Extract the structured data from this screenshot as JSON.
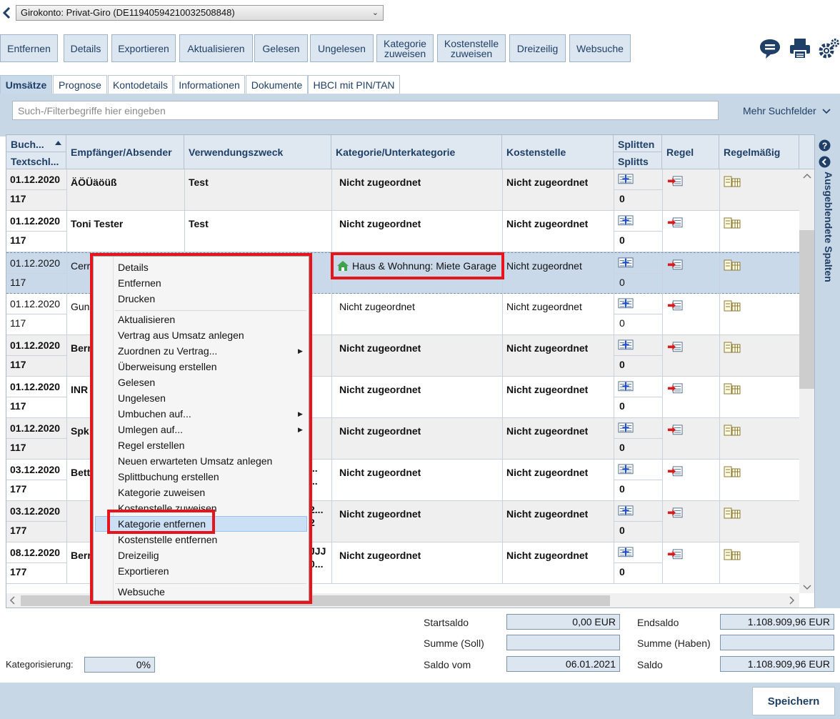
{
  "account": {
    "select_value": "Girokonto: Privat-Giro (DE11940594210032508848)"
  },
  "toolbar": {
    "buttons": [
      {
        "label": "Entfernen"
      },
      {
        "label": "Details"
      },
      {
        "label": "Exportieren"
      },
      {
        "label": "Aktualisieren"
      },
      {
        "label": "Gelesen"
      },
      {
        "label": "Ungelesen"
      },
      {
        "label": "Kategorie\nzuweisen"
      },
      {
        "label": "Kostenstelle\nzuweisen"
      },
      {
        "label": "Dreizeilig"
      },
      {
        "label": "Websuche"
      }
    ],
    "icons": [
      "chat-icon",
      "print-icon",
      "settings-icon"
    ]
  },
  "tabs": [
    {
      "label": "Umsätze",
      "active": true
    },
    {
      "label": "Prognose"
    },
    {
      "label": "Kontodetails"
    },
    {
      "label": "Informationen"
    },
    {
      "label": "Dokumente"
    },
    {
      "label": "HBCI mit PIN/TAN"
    }
  ],
  "search": {
    "placeholder": "Such-/Filterbegriffe hier eingeben",
    "more_label": "Mehr Suchfelder"
  },
  "table": {
    "headers": {
      "buch": "Buch...",
      "textschl": "Textschl...",
      "empfaenger": "Empfänger/Absender",
      "zweck": "Verwendungszweck",
      "kategorie": "Kategorie/Unterkategorie",
      "kostenstelle": "Kostenstelle",
      "splitten": "Splitten",
      "splitts": "Splitts",
      "regel": "Regel",
      "regelmaessig": "Regelmäßig"
    },
    "rows": [
      {
        "date": "01.12.2020",
        "code": "117",
        "empfaenger": "ÄÖÜäöüß",
        "zweck": "Test",
        "kategorie": "Nicht zugeordnet",
        "kostenstelle": "Nicht zugeordnet",
        "splitts": "0",
        "bold": true,
        "alt": true
      },
      {
        "date": "01.12.2020",
        "code": "117",
        "empfaenger": "Toni Tester",
        "zweck": "Test",
        "kategorie": "Nicht zugeordnet",
        "kostenstelle": "Nicht zugeordnet",
        "splitts": "0",
        "bold": true,
        "alt": false
      },
      {
        "date": "01.12.2020",
        "code": "117",
        "empfaenger": "Cerr",
        "zweck": "",
        "kategorie": "Haus & Wohnung: Miete Garage",
        "kostenstelle": "Nicht zugeordnet",
        "splitts": "0",
        "bold": false,
        "selected": true
      },
      {
        "date": "01.12.2020",
        "code": "117",
        "empfaenger": "Gun",
        "zweck": "",
        "kategorie": "Nicht zugeordnet",
        "kostenstelle": "Nicht zugeordnet",
        "splitts": "0",
        "bold": false,
        "alt": false
      },
      {
        "date": "01.12.2020",
        "code": "117",
        "empfaenger": "Berr",
        "zweck": "",
        "kategorie": "Nicht zugeordnet",
        "kostenstelle": "Nicht zugeordnet",
        "splitts": "0",
        "bold": true,
        "alt": true
      },
      {
        "date": "01.12.2020",
        "code": "117",
        "empfaenger": "INR",
        "zweck": "",
        "kategorie": "Nicht zugeordnet",
        "kostenstelle": "Nicht zugeordnet",
        "splitts": "0",
        "bold": true,
        "alt": false
      },
      {
        "date": "01.12.2020",
        "code": "117",
        "empfaenger": "Spk",
        "zweck": "",
        "kategorie": "Nicht zugeordnet",
        "kostenstelle": "Nicht zugeordnet",
        "splitts": "0",
        "bold": true,
        "alt": true
      },
      {
        "date": "03.12.2020",
        "code": "177",
        "empfaenger": "Bett",
        "zweck": "...",
        "zweck2": "...",
        "kategorie": "Nicht zugeordnet",
        "kostenstelle": "Nicht zugeordnet",
        "splitts": "0",
        "bold": true,
        "alt": false
      },
      {
        "date": "03.12.2020",
        "code": "177",
        "empfaenger": "",
        "zweck": "2...",
        "zweck2": "2",
        "kategorie": "Nicht zugeordnet",
        "kostenstelle": "Nicht zugeordnet",
        "splitts": "0",
        "bold": true,
        "alt": true
      },
      {
        "date": "08.12.2020",
        "code": "177",
        "empfaenger": "Berr",
        "zweck": "JJJ",
        "zweck2": "0...",
        "kategorie": "Nicht zugeordnet",
        "kostenstelle": "Nicht zugeordnet",
        "splitts": "0",
        "bold": true,
        "alt": false
      }
    ]
  },
  "side_panel": {
    "label": "Ausgeblendete Spalten"
  },
  "context_menu": {
    "group1": [
      "Details",
      "Entfernen",
      "Drucken"
    ],
    "group2": [
      "Aktualisieren",
      "Vertrag aus Umsatz anlegen",
      "Zuordnen zu Vertrag...",
      "Überweisung erstellen",
      "Gelesen",
      "Ungelesen",
      "Umbuchen auf...",
      "Umlegen auf...",
      "Regel erstellen",
      "Neuen erwarteten Umsatz anlegen",
      "Splittbuchung erstellen",
      "Kategorie zuweisen",
      "Kostenstelle zuweisen",
      "Kategorie entfernen",
      "Kostenstelle entfernen",
      "Dreizeilig",
      "Exportieren"
    ],
    "group3": [
      "Websuche"
    ],
    "highlighted": "Kategorie entfernen"
  },
  "summary": {
    "startsaldo_label": "Startsaldo",
    "startsaldo": "0,00 EUR",
    "endsaldo_label": "Endsaldo",
    "endsaldo": "1.108.909,96 EUR",
    "soll_label": "Summe (Soll)",
    "soll": "",
    "haben_label": "Summe (Haben)",
    "haben": "",
    "saldo_vom_label": "Saldo vom",
    "saldo_vom": "06.01.2021",
    "saldo_label": "Saldo",
    "saldo": "1.108.909,96 EUR",
    "kategorisierung_label": "Kategorisierung:",
    "kategorisierung": "0%"
  },
  "footer": {
    "save_label": "Speichern"
  },
  "colors": {
    "accent": "#1f3f66",
    "panel": "#c8d7e6",
    "highlight_box": "#e8141c"
  }
}
